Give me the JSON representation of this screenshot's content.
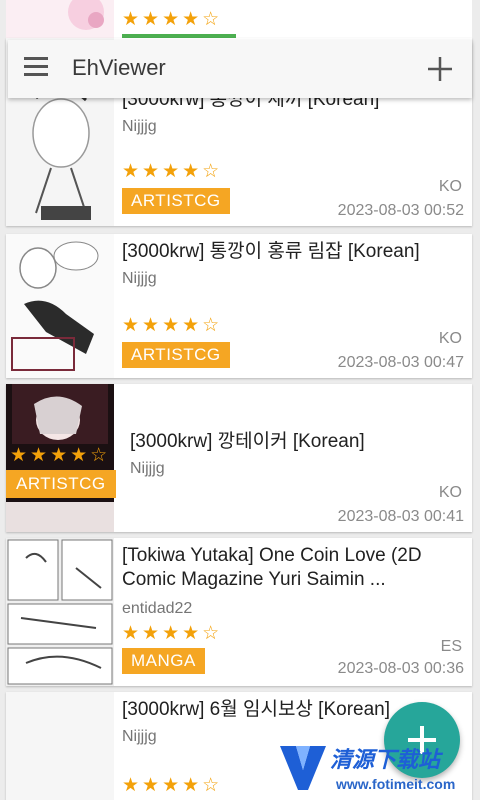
{
  "app": {
    "title": "EhViewer"
  },
  "top_partial": {
    "stars": "★★★★☆"
  },
  "items": [
    {
      "title": "[3000krw] 통깡이 세끼 [Korean]",
      "uploader": "Nijjjg",
      "stars": "★★★★☆",
      "category": "ARTISTCG",
      "language": "KO",
      "date": "2023-08-03 00:52"
    },
    {
      "title": "[3000krw] 통깡이 홍류 림잡 [Korean]",
      "uploader": "Nijjjg",
      "stars": "★★★★☆",
      "category": "ARTISTCG",
      "language": "KO",
      "date": "2023-08-03 00:47"
    },
    {
      "title": "[3000krw] 깡테이커 [Korean]",
      "uploader": "Nijjjg",
      "stars": "★★★★☆",
      "category": "ARTISTCG",
      "language": "KO",
      "date": "2023-08-03 00:41"
    },
    {
      "title": "[Tokiwa Yutaka] One Coin Love (2D Comic Magazine Yuri Saimin ...",
      "uploader": "entidad22",
      "stars": "★★★★☆",
      "category": "MANGA",
      "language": "ES",
      "date": "2023-08-03 00:36"
    },
    {
      "title": "[3000krw] 6월 임시보상 [Korean]",
      "uploader": "Nijjjg",
      "stars": "★★★★☆"
    }
  ],
  "icons": {
    "menu": "hamburger-icon",
    "add": "plus-icon",
    "fab": "plus-icon"
  },
  "colors": {
    "accent": "#f5a623",
    "fab": "#26a69a",
    "star": "#f3a10a",
    "progress": "#4caf50"
  },
  "watermark": {
    "text": "清源下载站",
    "url": "www.fotimeit.com"
  }
}
